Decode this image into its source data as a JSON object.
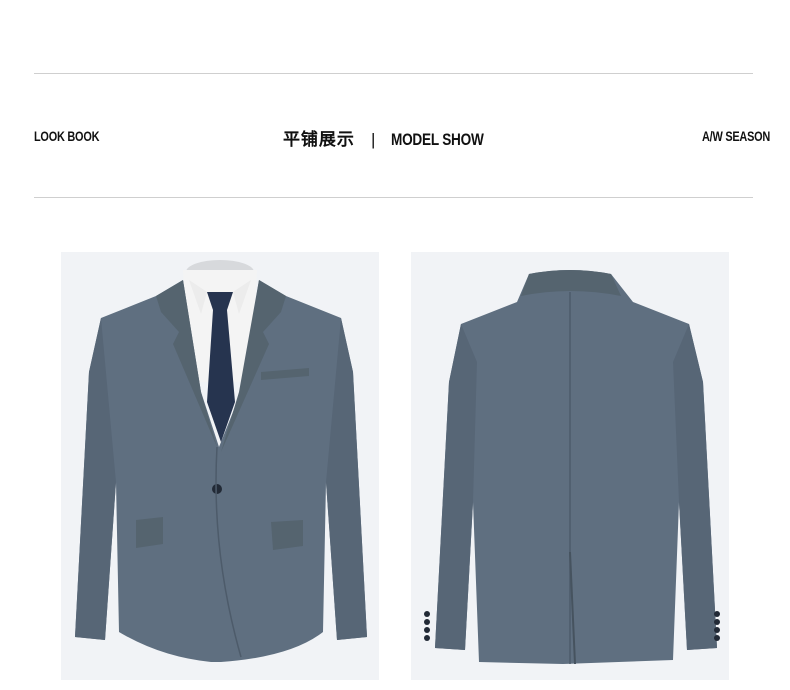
{
  "header": {
    "left_label": "LOOK BOOK",
    "center_cn": "平铺展示",
    "center_divider": "|",
    "center_en": "MODEL SHOW",
    "right_label": "A/W SEASON"
  },
  "colors": {
    "background": "#ffffff",
    "rule": "#cfcfcf",
    "panel_bg": "#f1f3f6",
    "suit": "#5f6f80",
    "suit_shadow": "#4d5b6a",
    "tie": "#26344f",
    "shirt": "#f4f4f4"
  },
  "images": [
    {
      "name": "jacket-front-image",
      "icon": "suit-jacket-front"
    },
    {
      "name": "jacket-back-image",
      "icon": "suit-jacket-back"
    }
  ]
}
